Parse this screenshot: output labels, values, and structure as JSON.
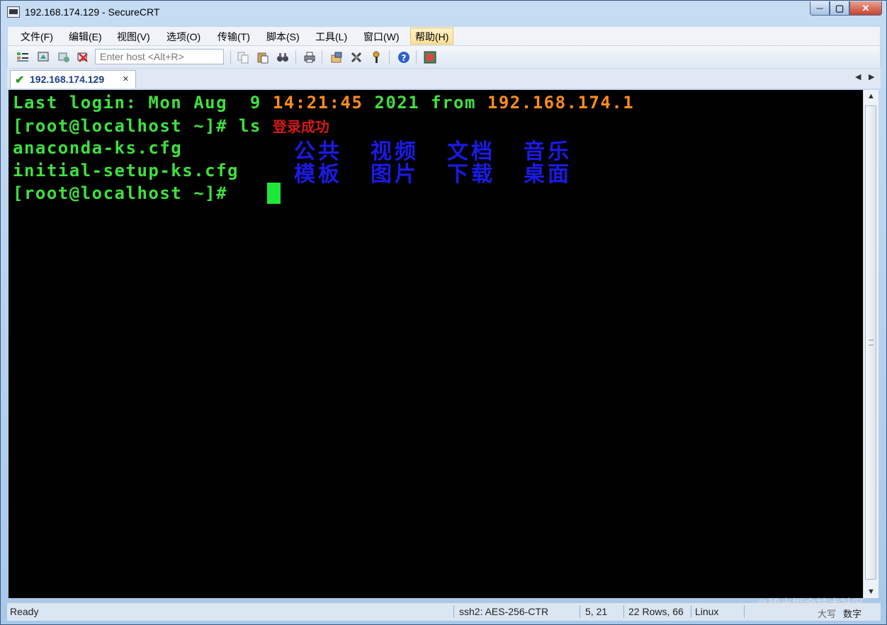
{
  "window": {
    "title": "192.168.174.129 - SecureCRT"
  },
  "menu": [
    "文件(F)",
    "编辑(E)",
    "视图(V)",
    "选项(O)",
    "传输(T)",
    "脚本(S)",
    "工具(L)",
    "窗口(W)",
    "帮助(H)"
  ],
  "toolbar": {
    "host_placeholder": "Enter host <Alt+R>"
  },
  "tab": {
    "label": "192.168.174.129",
    "close": "×"
  },
  "terminal": {
    "line1_a": "Last login: Mon Aug  9 ",
    "line1_time": "14:21:45",
    "line1_b": " 2021 from ",
    "line1_ip": "192.168.174.1",
    "line2_prompt": "[root@localhost ~]# ls",
    "line2_note": "登录成功",
    "line3": "anaconda-ks.cfg",
    "line4": "initial-setup-ks.cfg",
    "line5_prompt": "[root@localhost ~]#",
    "dirs_row1": [
      "公共",
      "视频",
      "文档",
      "音乐"
    ],
    "dirs_row2": [
      "模板",
      "图片",
      "下载",
      "桌面"
    ]
  },
  "status": {
    "ready": "Ready",
    "cipher": "ssh2: AES-256-CTR",
    "position": "5,  21",
    "size": "22 Rows, 66",
    "os": "Linux",
    "ime1": "大写",
    "ime2": "数字"
  },
  "watermark": "@稀土掘金技术社区"
}
